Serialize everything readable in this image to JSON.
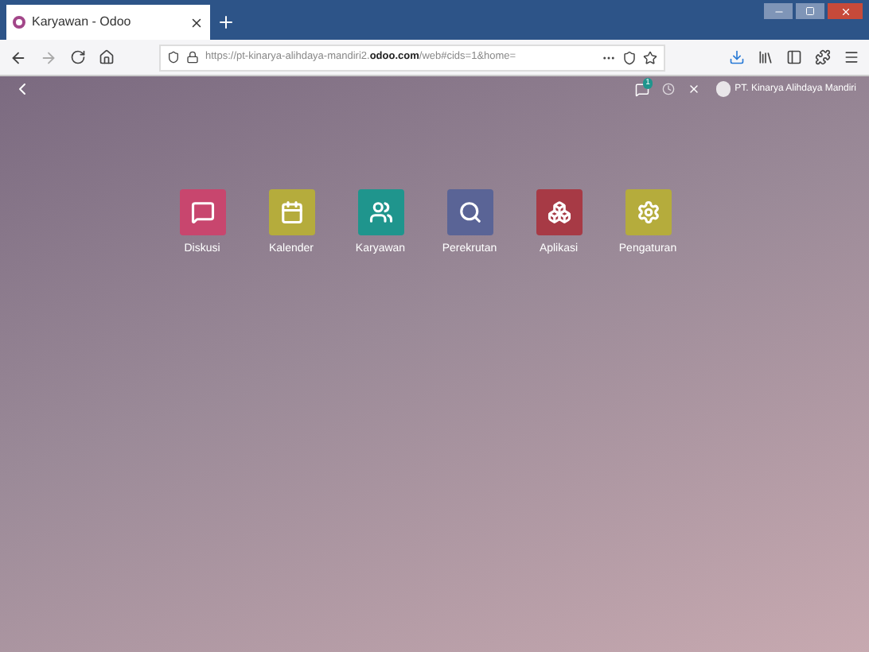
{
  "browser": {
    "tab_title": "Karyawan - Odoo",
    "url_prefix": "https://pt-kinarya-alihdaya-mandiri2.",
    "url_domain": "odoo.com",
    "url_suffix": "/web#cids=1&home="
  },
  "topbar": {
    "chat_count": "1",
    "company": "PT. Kinarya Alihdaya Mandiri"
  },
  "apps": [
    {
      "label": "Diskusi",
      "kind": "chat",
      "color": "#c8466e"
    },
    {
      "label": "Kalender",
      "kind": "calendar",
      "color": "#b5ac3c"
    },
    {
      "label": "Karyawan",
      "kind": "people",
      "color": "#1f958d"
    },
    {
      "label": "Perekrutan",
      "kind": "search",
      "color": "#5a6496"
    },
    {
      "label": "Aplikasi",
      "kind": "cubes",
      "color": "#a73a45"
    },
    {
      "label": "Pengaturan",
      "kind": "gear",
      "color": "#b5ac3c"
    }
  ]
}
